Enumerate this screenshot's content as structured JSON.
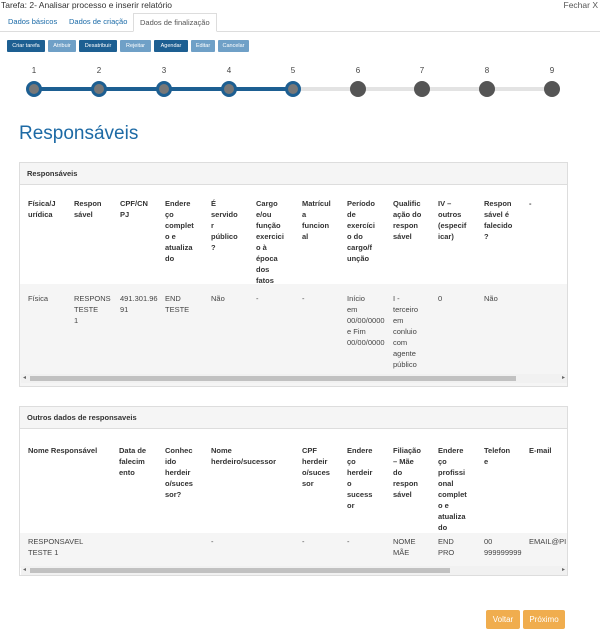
{
  "header": {
    "task_title": "Tarefa: 2- Analisar processo e inserir relatório",
    "close_label": "Fechar X"
  },
  "tabs": [
    {
      "label": "Dados básicos",
      "active": false
    },
    {
      "label": "Dados de criação",
      "active": false
    },
    {
      "label": "Dados de finalização",
      "active": true
    }
  ],
  "actions": [
    {
      "label": "Criar tarefa",
      "style": "dark"
    },
    {
      "label": "Atribuir",
      "style": "light"
    },
    {
      "label": "Desatribuir",
      "style": "dark"
    },
    {
      "label": "Rejeitar",
      "style": "light"
    },
    {
      "label": "Agendar",
      "style": "dark"
    },
    {
      "label": "Editar",
      "style": "light"
    },
    {
      "label": "Cancelar",
      "style": "light"
    }
  ],
  "stepper": {
    "steps": [
      "1",
      "2",
      "3",
      "4",
      "5",
      "6",
      "7",
      "8",
      "9"
    ],
    "completed_through": 5,
    "colors": {
      "done": "#1d5f92",
      "pending": "#e3e3e3"
    }
  },
  "page_title": "Responsáveis",
  "panel1": {
    "title": "Responsáveis",
    "headers": [
      "Física/J\nurídica",
      "Respon\nsável",
      "CPF/CN\nPJ",
      "Endere\nço\ncomplet\no e\natualiza\ndo",
      "É\nservido\nr\npúblico\n?",
      "Cargo\ne/ou\nfunção\nexercici\no à\népoca\ndos\nfatos",
      "Matrícul\na\nfuncion\nal",
      "Período\nde\nexercíci\no do\ncargo/f\nunção",
      "Qualific\nação do\nrespon\nsável",
      "IV –\noutros\n(especif\nicar)",
      "Respon\nsável é\nfalecido\n?",
      "-"
    ],
    "row": [
      "Física",
      "RESPONS\nTESTE\n1",
      "491.301.96\n91",
      "END\nTESTE",
      "Não",
      "-",
      "-",
      "Início\nem\n00/00/0000\ne Fim\n00/00/0000",
      "I -\nterceiro\nem\nconluio\ncom\nagente\npúblico",
      "0",
      "Não",
      ""
    ]
  },
  "panel2": {
    "title": "Outros dados de responsaveis",
    "headers": [
      "Nome Responsável",
      "Data de\nfalecim\nento",
      "Conhec\nido\nherdeir\no/suces\nsor?",
      "Nome\nherdeiro/sucessor",
      "CPF\nherdeir\no/suces\nsor",
      "Endere\nço\nherdeir\no\nsucess\nor",
      "Filiação\n– Mãe\ndo\nrespon\nsável",
      "Endere\nço\nprofissi\nonal\ncomplet\no e\natualiza\ndo",
      "Telefon\ne",
      "E-mail"
    ],
    "row": [
      "RESPONSAVEL\nTESTE 1",
      "",
      "",
      "-",
      "-",
      "-",
      "NOME\nMÃE",
      "END\nPRO",
      "00\n999999999",
      "EMAIL@PI"
    ]
  },
  "footer": {
    "back_label": "Voltar",
    "next_label": "Próximo"
  }
}
